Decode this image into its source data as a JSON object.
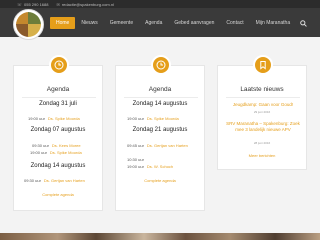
{
  "topbar": {
    "phone": "055 290 1688",
    "email": "redactie@spakenburg.com.nl"
  },
  "nav": {
    "items": [
      {
        "label": "Home",
        "active": true
      },
      {
        "label": "Nieuws",
        "active": false
      },
      {
        "label": "Gemeente",
        "active": false
      },
      {
        "label": "Agenda",
        "active": false
      },
      {
        "label": "Gebed aanvragen",
        "active": false
      },
      {
        "label": "Contact",
        "active": false
      },
      {
        "label": "Mijn Maranatha",
        "active": false
      }
    ]
  },
  "col1": {
    "title": "Agenda",
    "days": [
      {
        "date": "Zondag 31 juli",
        "events": [
          {
            "time": "19:00 uur",
            "preacher": "Ds. Spike Moorda"
          }
        ]
      },
      {
        "date": "Zondag 07 augustus",
        "events": [
          {
            "time": "09:30 uur",
            "preacher": "Ds. Kees Moree"
          },
          {
            "time": "19:00 uur",
            "preacher": "Ds. Spike Moorda"
          }
        ]
      },
      {
        "date": "Zondag 14 augustus",
        "events": [
          {
            "time": "09:30 uur",
            "preacher": "Ds. Gertjan van Harten"
          }
        ]
      }
    ],
    "link": "Complete agenda"
  },
  "col2": {
    "title": "Agenda",
    "days": [
      {
        "date": "Zondag 14 augustus",
        "events": [
          {
            "time": "19:00 uur",
            "preacher": "Ds. Spike Moorda"
          }
        ]
      },
      {
        "date": "Zondag 21 augustus",
        "events": [
          {
            "time": "09:45 uur",
            "preacher": "Ds. Gertjan van Harten"
          },
          {
            "time": "10:30 uur",
            "preacher": ""
          },
          {
            "time": "19:00 uur",
            "preacher": "Ds. W. Schoch"
          }
        ]
      }
    ],
    "link": "Complete agenda"
  },
  "col3": {
    "title": "Laatste nieuws",
    "items": [
      {
        "title": "Jeugdkamp: Gaan voor Goud!",
        "date": "29 juni 2016"
      },
      {
        "title": "SRV Maranatha – Spakenburg: Zoek mee 3 landelijk nieuwe APV",
        "date": "28 juni 2016"
      }
    ],
    "link": "Meer berichten"
  },
  "colors": {
    "accent": "#e59e1a",
    "nav_bg": "#3a3a3a",
    "topbar_bg": "#2c2c2c"
  },
  "icons": {
    "agenda_badge": "clock-icon",
    "news_badge": "bookmark-icon",
    "search": "search-icon"
  }
}
